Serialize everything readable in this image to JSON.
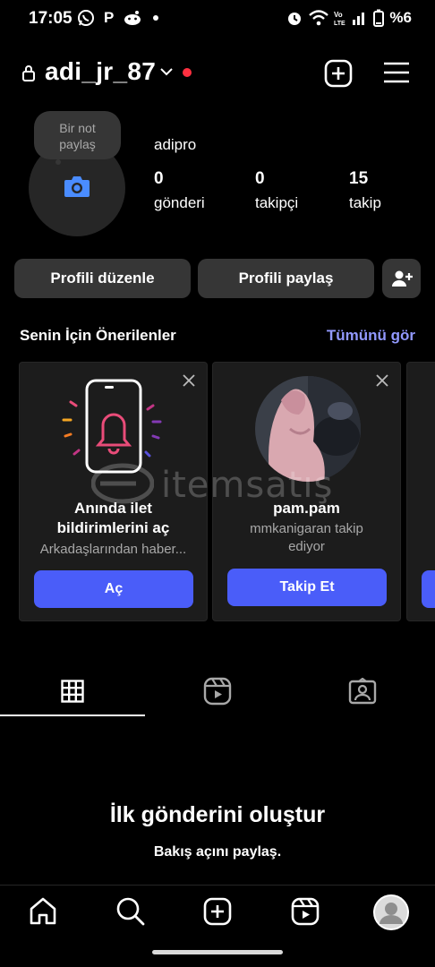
{
  "status_bar": {
    "time": "17:05",
    "left_icons": [
      "whatsapp-icon",
      "p-icon",
      "reddit-icon",
      "dot-icon"
    ],
    "p_glyph": "P",
    "right_icons": [
      "alarm-icon",
      "wifi-icon",
      "volte-icon",
      "signal-icon",
      "battery-icon"
    ],
    "battery": "%6"
  },
  "header": {
    "username": "adi_jr_87",
    "notification_dot_color": "#ff3040"
  },
  "profile": {
    "note_line1": "Bir not",
    "note_line2": "paylaş",
    "display_name": "adipro",
    "stats": [
      {
        "value": "0",
        "label": "gönderi"
      },
      {
        "value": "0",
        "label": "takipçi"
      },
      {
        "value": "15",
        "label": "takip"
      }
    ]
  },
  "actions": {
    "edit_profile": "Profili düzenle",
    "share_profile": "Profili paylaş"
  },
  "suggestions": {
    "title": "Senin İçin Önerilenler",
    "see_all": "Tümünü gör",
    "cards": [
      {
        "title_line1": "Anında ilet",
        "title_line2": "bildirimlerini aç",
        "subtitle": "Arkadaşlarından haber...",
        "button": "Aç"
      },
      {
        "title": "pam.pam",
        "subtitle_line1": "mmkanigaran takip",
        "subtitle_line2": "ediyor",
        "button": "Takip Et"
      }
    ]
  },
  "watermark": {
    "text": "itemsatış"
  },
  "tabs": [
    "grid-icon",
    "reels-icon",
    "tagged-icon"
  ],
  "empty_state": {
    "title": "İlk gönderini oluştur",
    "subtitle": "Bakış açını paylaş."
  },
  "bottom_nav": [
    "home-icon",
    "search-icon",
    "create-icon",
    "reels-icon",
    "profile-avatar"
  ],
  "colors": {
    "accent": "#4a5df9",
    "link": "#9299ff",
    "surface": "#363636",
    "card": "#1c1c1c"
  }
}
